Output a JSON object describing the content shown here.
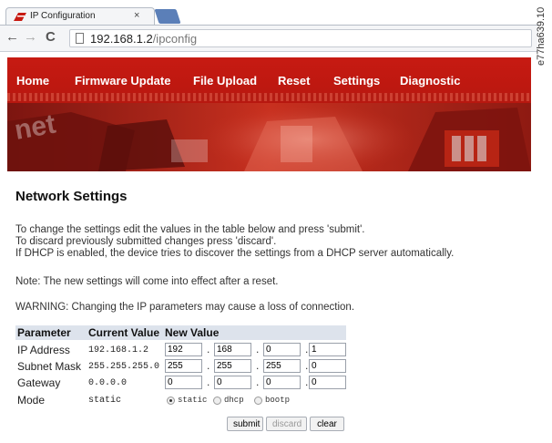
{
  "browser": {
    "tab_title": "IP Configuration",
    "tab_close": "×",
    "url_host": "192.168.1.2",
    "url_path": "/ipconfig",
    "back_icon": "←",
    "forward_icon": "→",
    "reload_icon": "C"
  },
  "side_label": "e77ha639.10",
  "nav": {
    "items": [
      {
        "label": "Home"
      },
      {
        "label": "Firmware Update"
      },
      {
        "label": "File Upload"
      },
      {
        "label": "Reset"
      },
      {
        "label": "Settings"
      },
      {
        "label": "Diagnostic"
      }
    ]
  },
  "banner": {
    "logo_text": "net"
  },
  "page": {
    "title": "Network Settings",
    "intro": [
      "To change the settings edit the values in the table below and press 'submit'.",
      "To discard previously submitted changes press 'discard'.",
      "If DHCP is enabled, the device tries to discover the settings from a DHCP server automatically."
    ],
    "note": "Note: The new settings will come into effect after a reset.",
    "warning": "WARNING: Changing the IP parameters may cause a loss of connection."
  },
  "table": {
    "headers": [
      "Parameter",
      "Current Value",
      "New Value"
    ],
    "rows": [
      {
        "parameter": "IP Address",
        "current": "192.168.1.2",
        "new": [
          "192",
          "168",
          "0",
          "1"
        ]
      },
      {
        "parameter": "Subnet Mask",
        "current": "255.255.255.0",
        "new": [
          "255",
          "255",
          "255",
          "0"
        ]
      },
      {
        "parameter": "Gateway",
        "current": "0.0.0.0",
        "new": [
          "0",
          "0",
          "0",
          "0"
        ]
      }
    ],
    "separator": ".",
    "mode": {
      "parameter": "Mode",
      "current": "static",
      "options": [
        "static",
        "dhcp",
        "bootp"
      ],
      "selected": "static"
    },
    "buttons": {
      "submit": "submit",
      "discard": "discard",
      "clear": "clear"
    }
  },
  "colors": {
    "banner_red": "#c71a12",
    "header_row": "#dde3ec",
    "tab_blue": "#5b7fb8"
  }
}
